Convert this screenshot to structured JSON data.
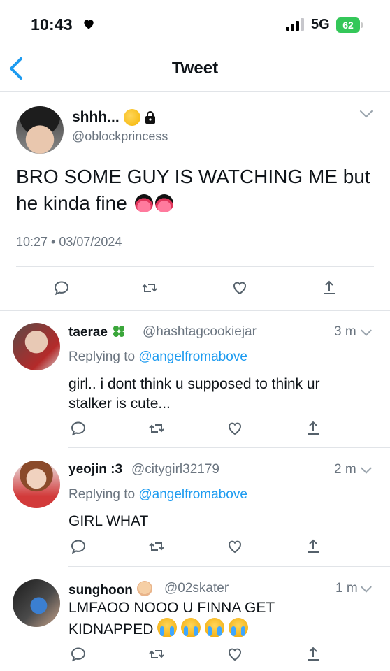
{
  "status_bar": {
    "time": "10:43",
    "network": "5G",
    "battery": "62"
  },
  "nav": {
    "title": "Tweet"
  },
  "main_tweet": {
    "display_name": "shhh...",
    "handle": "@oblockprincess",
    "text": "BRO SOME GUY IS WATCHING ME but he kinda fine",
    "timestamp": "10:27 • 03/07/2024"
  },
  "replies": [
    {
      "display_name": "taerae",
      "handle": "@hashtagcookiejar",
      "time": "3 m",
      "replying_prefix": "Replying to",
      "replying_to": "@angelfromabove",
      "text": "girl.. i dont think u supposed to think ur stalker is cute..."
    },
    {
      "display_name": "yeojin :3",
      "handle": "@citygirl32179",
      "time": "2 m",
      "replying_prefix": "Replying to",
      "replying_to": "@angelfromabove",
      "text": "GIRL WHAT"
    },
    {
      "display_name": "sunghoon",
      "handle": "@02skater",
      "time": "1 m",
      "text": "LMFAOO NOOO U FINNA GET KIDNAPPED"
    }
  ],
  "colors": {
    "accent": "#1d9bf0",
    "muted": "#6b7580",
    "divider": "#e1e4e8",
    "battery": "#34c759"
  },
  "icons": [
    "heart-icon",
    "back-chevron-icon",
    "chevron-down-icon",
    "reply-icon",
    "retweet-icon",
    "like-icon",
    "share-icon"
  ]
}
